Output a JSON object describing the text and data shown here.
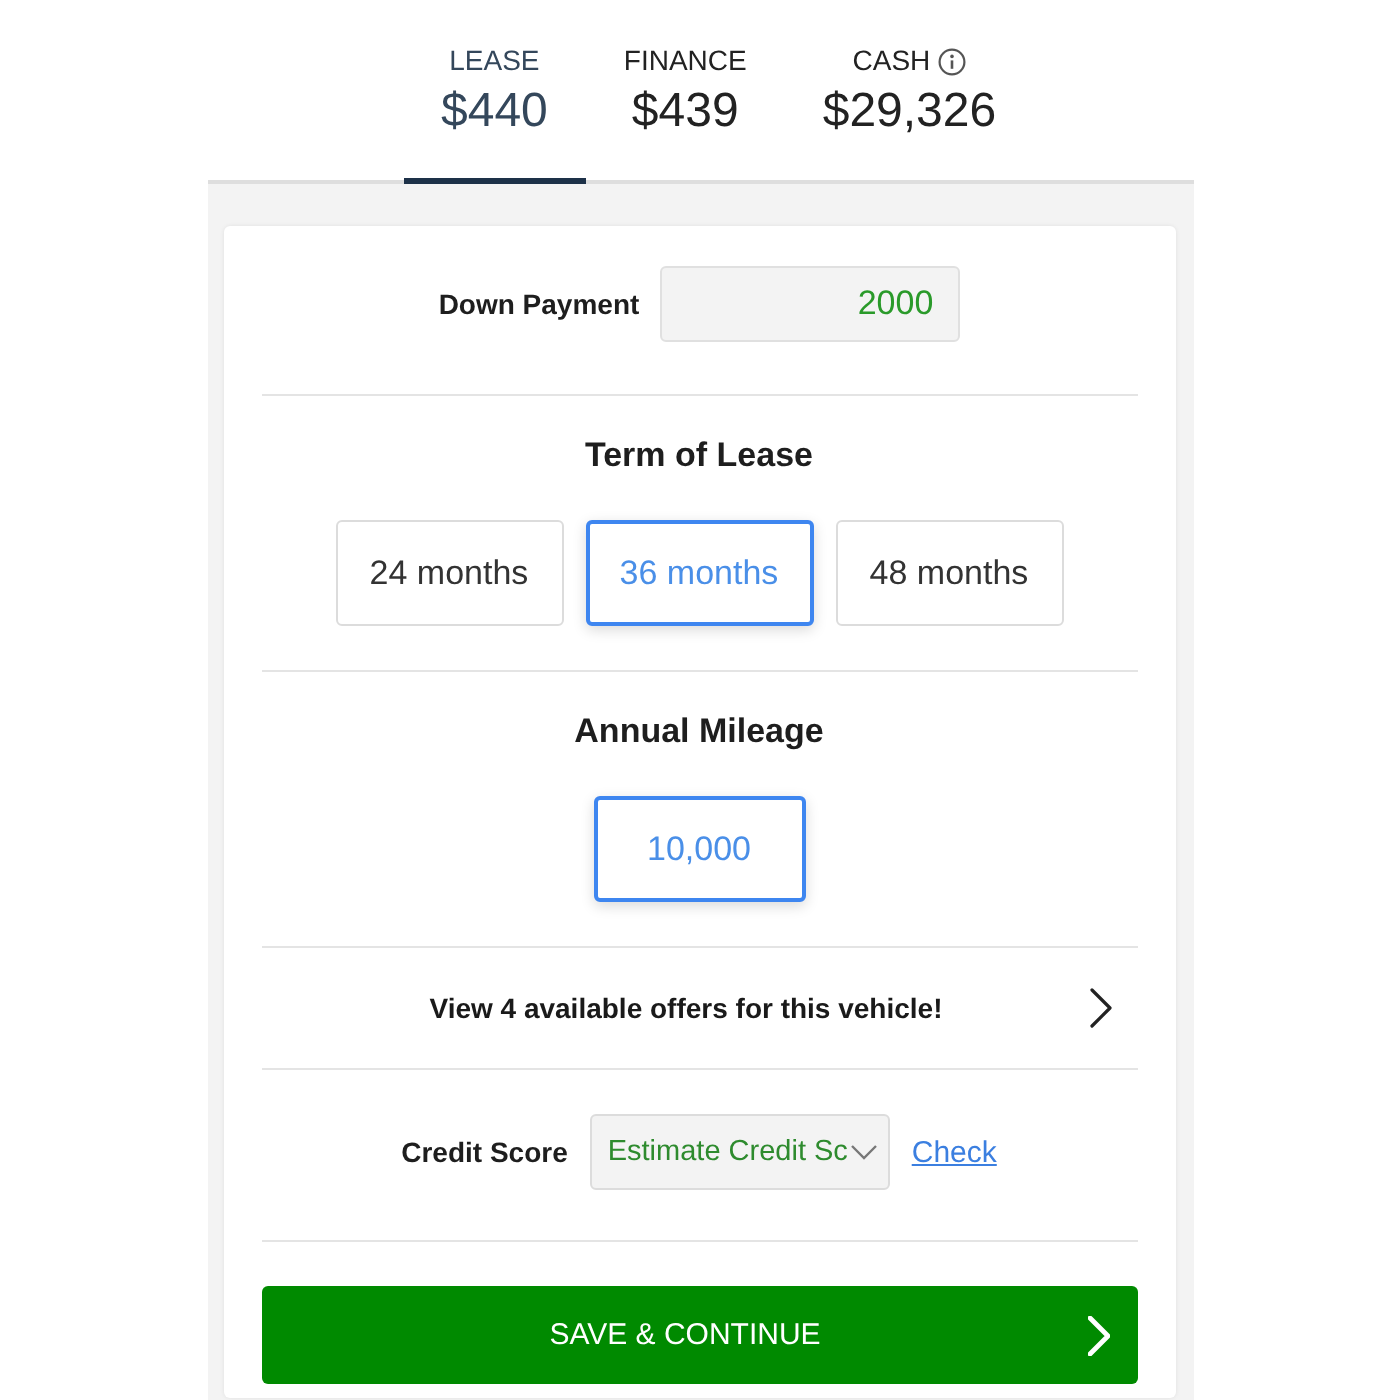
{
  "tabs": [
    {
      "label": "LEASE",
      "price": "$440",
      "selected": true,
      "info_icon": false
    },
    {
      "label": "FINANCE",
      "price": "$439",
      "selected": false,
      "info_icon": false
    },
    {
      "label": "CASH",
      "price": "$29,326",
      "selected": false,
      "info_icon": true
    }
  ],
  "down_payment": {
    "label": "Down Payment",
    "value": "2000"
  },
  "lease_term": {
    "title": "Term of Lease",
    "options": [
      {
        "label": "24 months",
        "selected": false
      },
      {
        "label": "36 months",
        "selected": true
      },
      {
        "label": "48 months",
        "selected": false
      }
    ]
  },
  "annual_mileage": {
    "title": "Annual Mileage",
    "options": [
      {
        "label": "10,000",
        "selected": true
      }
    ]
  },
  "offers": {
    "text": "View 4 available offers for this vehicle!"
  },
  "credit_score": {
    "label": "Credit Score",
    "value": "Estimate Credit Sc",
    "link": "Check"
  },
  "save_button": {
    "label": "SAVE & CONTINUE"
  }
}
